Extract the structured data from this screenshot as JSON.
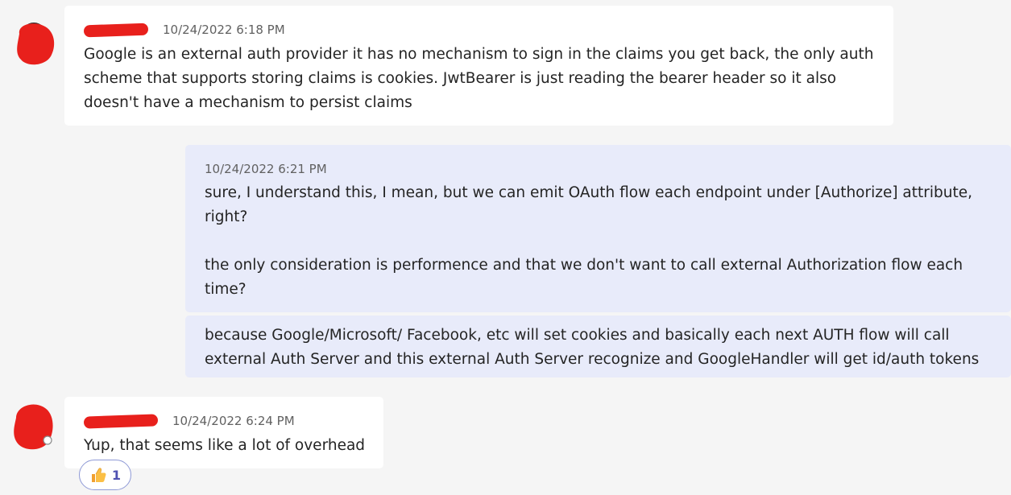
{
  "messages": [
    {
      "timestamp": "10/24/2022 6:18 PM",
      "text": "Google is an external auth provider it has no mechanism to sign in the claims you get back, the only auth\nscheme that supports storing claims is cookies. JwtBearer is just reading the bearer header so it also\ndoesn't have a mechanism to persist claims"
    },
    {
      "timestamp": "10/24/2022 6:21 PM",
      "text": "sure, I understand this, I mean, but we can emit OAuth flow each endpoint under [Authorize] attribute,\nright?\n\nthe only consideration is performence and that we don't want to call external Authorization flow each\ntime?"
    },
    {
      "text": "because Google/Microsoft/ Facebook, etc will set cookies and basically each next AUTH flow will call\nexternal Auth Server and this external Auth Server recognize and GoogleHandler will get id/auth tokens"
    },
    {
      "timestamp": "10/24/2022 6:24 PM",
      "text": "Yup, that seems like a lot of overhead",
      "reaction": {
        "icon": "thumbs-up-icon",
        "count": "1"
      }
    }
  ],
  "colors": {
    "background": "#f5f5f5",
    "incoming_bubble": "#ffffff",
    "outgoing_bubble": "#e8ebfa",
    "redaction": "#e8201c",
    "reaction_accent": "#4f52b2"
  }
}
